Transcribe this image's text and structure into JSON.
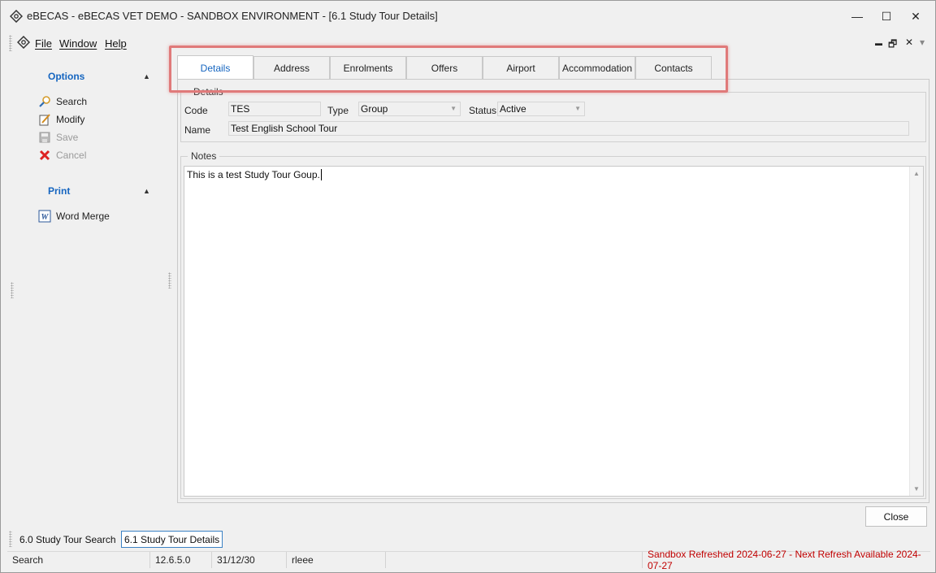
{
  "window": {
    "title": "eBECAS - eBECAS VET DEMO - SANDBOX ENVIRONMENT - [6.1 Study Tour Details]",
    "controls": {
      "minimize": "—",
      "maximize": "☐",
      "close": "✕"
    }
  },
  "menu": {
    "items": [
      "File",
      "Window",
      "Help"
    ],
    "mdi": {
      "minimize": "▬",
      "restore": "🗗",
      "close": "✕",
      "dropdown": "▾"
    }
  },
  "sidebar": {
    "options_header": "Options",
    "options": [
      {
        "label": "Search",
        "icon": "search-icon",
        "enabled": true
      },
      {
        "label": "Modify",
        "icon": "edit-icon",
        "enabled": true
      },
      {
        "label": "Save",
        "icon": "save-icon",
        "enabled": false
      },
      {
        "label": "Cancel",
        "icon": "cancel-icon",
        "enabled": false
      }
    ],
    "print_header": "Print",
    "print": [
      {
        "label": "Word Merge",
        "icon": "word-icon",
        "enabled": true
      }
    ]
  },
  "tabs": [
    "Details",
    "Address",
    "Enrolments",
    "Offers",
    "Airport",
    "Accommodation",
    "Contacts"
  ],
  "active_tab": "Details",
  "details": {
    "section_title": "Details",
    "code_label": "Code",
    "code_value": "TES",
    "type_label": "Type",
    "type_value": "Group",
    "status_label": "Status",
    "status_value": "Active",
    "name_label": "Name",
    "name_value": "Test English School Tour"
  },
  "notes": {
    "section_title": "Notes",
    "text": "This is a test Study Tour Goup."
  },
  "buttons": {
    "close": "Close"
  },
  "window_tabs": [
    {
      "label": "6.0 Study Tour Search",
      "active": false
    },
    {
      "label": "6.1 Study Tour Details",
      "active": true
    }
  ],
  "statusbar": {
    "mode": "Search",
    "version": "12.6.5.0",
    "date": "31/12/30",
    "user": "rleee",
    "alert": "Sandbox Refreshed 2024-06-27 - Next Refresh Available 2024-07-27",
    "alert_color": "#c00000"
  },
  "colors": {
    "accent": "#1565c0",
    "highlight": "#e07a7a"
  }
}
